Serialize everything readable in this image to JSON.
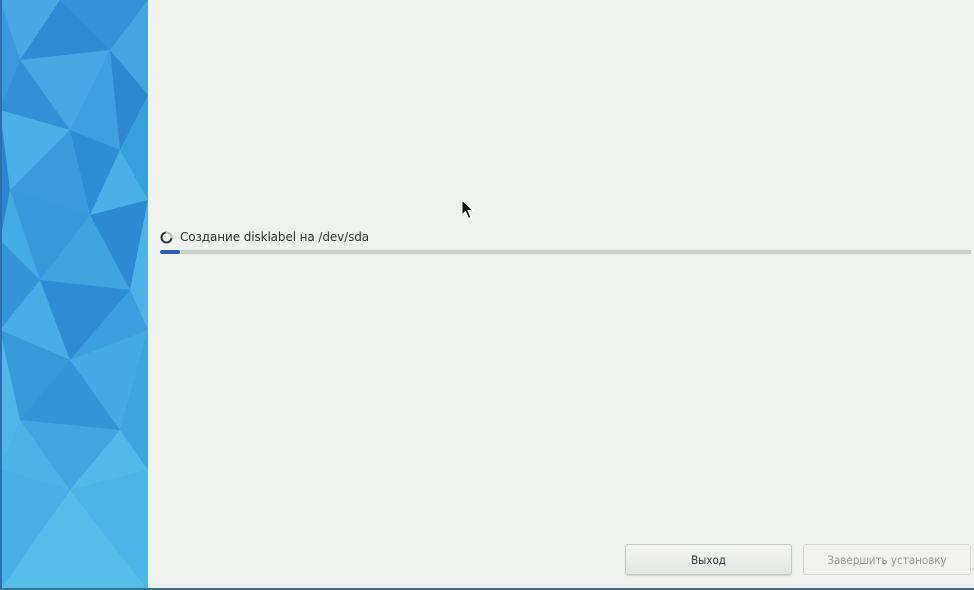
{
  "sidebar": {
    "accent_color": "#3a9ad9",
    "background": "low-poly blue pattern"
  },
  "progress": {
    "status_text": "Создание disklabel на /dev/sda",
    "fraction": 0.025,
    "spinner_icon": "spinner-icon",
    "bar_color": "#2a5db8"
  },
  "buttons": {
    "quit_label": "Выход",
    "finish_label": "Завершить установку",
    "finish_enabled": false
  },
  "cursor": {
    "icon": "mouse-pointer-icon"
  }
}
